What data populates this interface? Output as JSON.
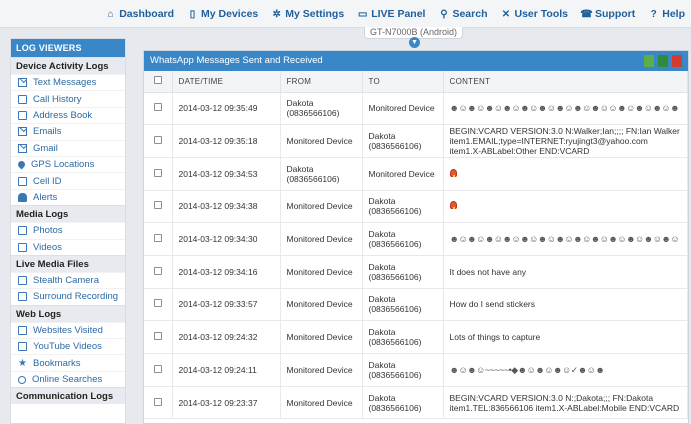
{
  "nav": [
    {
      "label": "Dashboard",
      "icon": "home-icon"
    },
    {
      "label": "My Devices",
      "icon": "devices-icon"
    },
    {
      "label": "My Settings",
      "icon": "gear-icon"
    },
    {
      "label": "LIVE Panel",
      "icon": "monitor-icon"
    },
    {
      "label": "Search",
      "icon": "search-icon"
    },
    {
      "label": "User Tools",
      "icon": "tools-icon"
    },
    {
      "label": "Support",
      "icon": "phone-icon"
    },
    {
      "label": "Help",
      "icon": "help-icon"
    }
  ],
  "device": {
    "name": "GT-N7000B (Android)"
  },
  "sidebar": {
    "header": "LOG VIEWERS",
    "sections": [
      {
        "title": "Device Activity Logs",
        "items": [
          "Text Messages",
          "Call History",
          "Address Book",
          "Emails",
          "Gmail",
          "GPS Locations",
          "Cell ID",
          "Alerts"
        ]
      },
      {
        "title": "Media Logs",
        "items": [
          "Photos",
          "Videos"
        ]
      },
      {
        "title": "Live Media Files",
        "items": [
          "Stealth Camera",
          "Surround Recording"
        ]
      },
      {
        "title": "Web Logs",
        "items": [
          "Websites Visited",
          "YouTube Videos",
          "Bookmarks",
          "Online Searches"
        ]
      },
      {
        "title": "Communication Logs",
        "items": []
      }
    ]
  },
  "panel": {
    "title": "WhatsApp Messages Sent and Received",
    "columns": {
      "date": "DATE/TIME",
      "from": "FROM",
      "to": "TO",
      "content": "CONTENT"
    }
  },
  "rows": [
    {
      "date": "2014-03-12 09:35:49",
      "from": "Dakota (0836566106)",
      "to": "Monitored Device",
      "content": "☻☺☻☺☻☺☻☺☻☺☻☺☻☺☻☺☻☺☺☻☺☻☺☻☺☻☺☻☺☻☺☻☺☻☺☻☻☺☻☺",
      "type": "emoji"
    },
    {
      "date": "2014-03-12 09:35:18",
      "from": "Monitored Device",
      "to": "Dakota (0836566106)",
      "content": "BEGIN:VCARD VERSION:3.0 N:Walker;Ian;;;; FN:Ian Walker item1.EMAIL;type=INTERNET:ryujingt3@yahoo.com item1.X-ABLabel:Other END:VCARD",
      "type": "text"
    },
    {
      "date": "2014-03-12 09:34:53",
      "from": "Dakota (0836566106)",
      "to": "Monitored Device",
      "content": "",
      "type": "image"
    },
    {
      "date": "2014-03-12 09:34:38",
      "from": "Monitored Device",
      "to": "Dakota (0836566106)",
      "content": "",
      "type": "image"
    },
    {
      "date": "2014-03-12 09:34:30",
      "from": "Monitored Device",
      "to": "Dakota (0836566106)",
      "content": "☻☺☻☺☻☺☻☺☻☺☻☺☻☺☻☺☻☺☻☺☻☺☻☺☻☺☻☺☻☺☻☺☻☺☻☺☻☺☻",
      "type": "emoji"
    },
    {
      "date": "2014-03-12 09:34:16",
      "from": "Monitored Device",
      "to": "Dakota (0836566106)",
      "content": "It does not have any",
      "type": "text"
    },
    {
      "date": "2014-03-12 09:33:57",
      "from": "Monitored Device",
      "to": "Dakota (0836566106)",
      "content": "How do I send stickers",
      "type": "text"
    },
    {
      "date": "2014-03-12 09:24:32",
      "from": "Monitored Device",
      "to": "Dakota (0836566106)",
      "content": "Lots of things to capture",
      "type": "text"
    },
    {
      "date": "2014-03-12 09:24:11",
      "from": "Monitored Device",
      "to": "Dakota (0836566106)",
      "content": "☻☺☻☺~~~~~•◆☻☺☻☺☻☺✓☻☺☻",
      "type": "emoji"
    },
    {
      "date": "2014-03-12 09:23:37",
      "from": "Monitored Device",
      "to": "Dakota (0836566106)",
      "content": "BEGIN:VCARD VERSION:3.0 N:;Dakota;;; FN:Dakota item1.TEL:836566106 item1.X-ABLabel:Mobile END:VCARD",
      "type": "text"
    }
  ]
}
